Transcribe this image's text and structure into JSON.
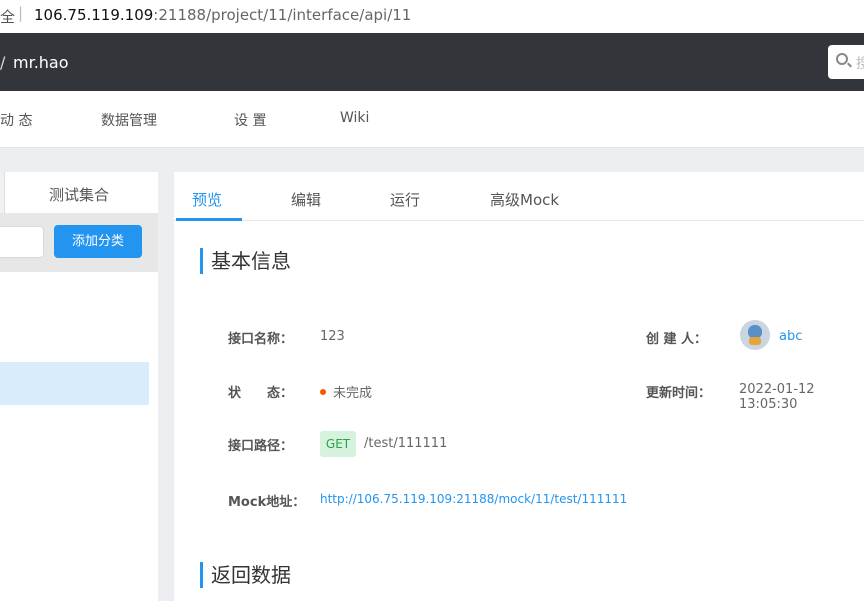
{
  "browser": {
    "secure_text": "全",
    "separator": "|",
    "url_host": "106.75.119.109",
    "url_path": ":21188/project/11/interface/api/11"
  },
  "header": {
    "slash": "/",
    "user": "mr.hao",
    "search_placeholder": "搜"
  },
  "subnav": {
    "items": [
      "动 态",
      "数据管理",
      "设 置",
      "Wiki"
    ]
  },
  "sidebar": {
    "tab_collection": "测试集合",
    "add_category": "添加分类"
  },
  "tabs": [
    "预览",
    "编辑",
    "运行",
    "高级Mock"
  ],
  "basic_info": {
    "title": "基本信息",
    "name_label": "接口名称：",
    "name_value": "123",
    "creator_label": "创 建 人：",
    "creator_value": "abc",
    "status_label": "状　　态：",
    "status_value": "未完成",
    "status_color": "#ff5500",
    "updated_label": "更新时间：",
    "updated_value": "2022-01-12 13:05:30",
    "path_label": "接口路径：",
    "method": "GET",
    "path_value": "/test/111111",
    "mock_label": "Mock地址：",
    "mock_value": "http://106.75.119.109:21188/mock/11/test/111111"
  },
  "return_data": {
    "title": "返回数据"
  },
  "colors": {
    "accent": "#2395f1",
    "topbar": "#32363a"
  }
}
